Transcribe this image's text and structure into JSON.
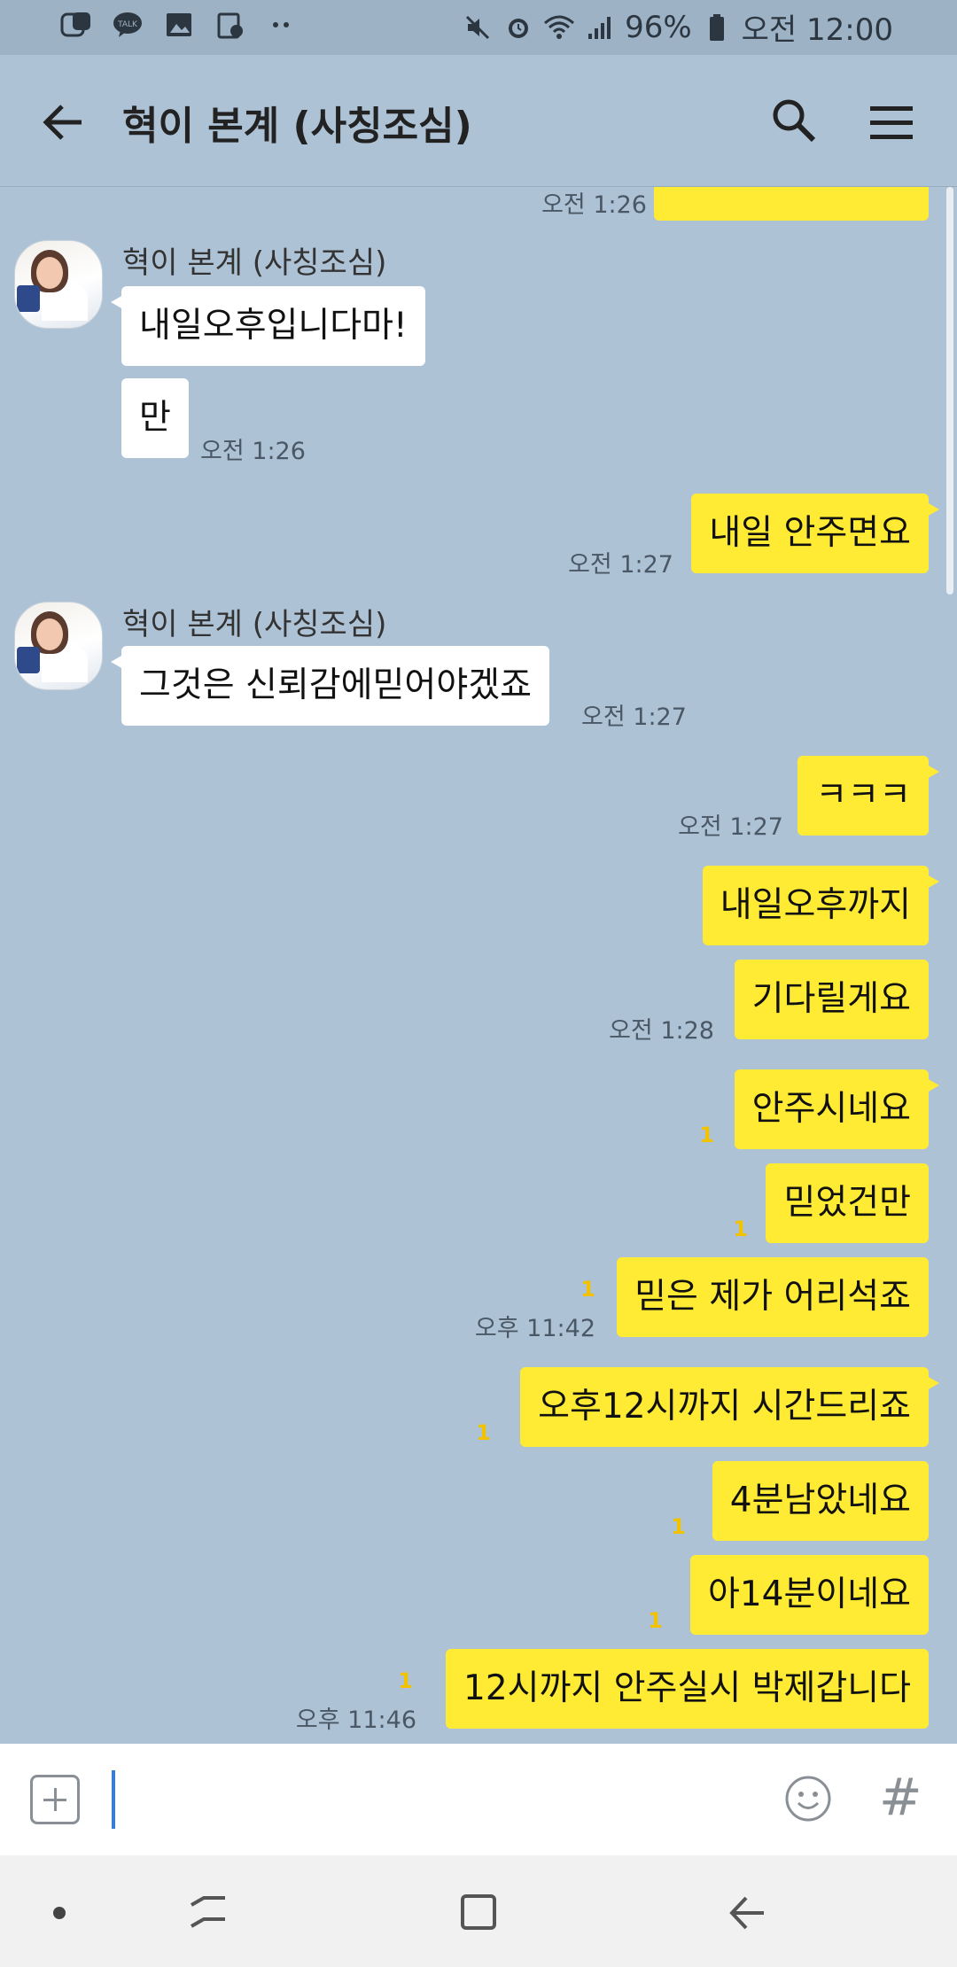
{
  "status": {
    "battery": "96%",
    "time": "오전 12:00"
  },
  "header": {
    "title": "혁이 본계 (사칭조심)"
  },
  "chat": {
    "partial_time": "오전 1:26",
    "sender1": "혁이 본계 (사칭조심)",
    "m1": "내일오후입니다마!",
    "m2": "만",
    "m2_time": "오전 1:26",
    "m3": "내일 안주면요",
    "m3_time": "오전 1:27",
    "sender2": "혁이 본계 (사칭조심)",
    "m4": "그것은 신뢰감에믿어야겠죠",
    "m4_time": "오전 1:27",
    "m5": "ㅋㅋㅋ",
    "m5_time": "오전 1:27",
    "m6": "내일오후까지",
    "m7": "기다릴게요",
    "m7_time": "오전 1:28",
    "m8": "안주시네요",
    "m8_unread": "1",
    "m9": "믿었건만",
    "m9_unread": "1",
    "m10": "믿은 제가 어리석죠",
    "m10_unread": "1",
    "m10_time": "오후 11:42",
    "m11": "오후12시까지 시간드리죠",
    "m11_unread": "1",
    "m12": "4분남았네요",
    "m12_unread": "1",
    "m13": "아14분이네요",
    "m13_unread": "1",
    "m14": "12시까지 안주실시 박제갑니다",
    "m14_unread": "1",
    "m14_time": "오후 11:46"
  },
  "input": {
    "value": "",
    "hash": "#"
  },
  "colors": {
    "background": "#aec2d6",
    "my_bubble": "#ffeb33",
    "their_bubble": "#ffffff",
    "unread": "#f2c200"
  },
  "icons": [
    "talk-app-icon",
    "kakaotalk-icon",
    "gallery-icon",
    "calendar-icon",
    "mute-icon",
    "alarm-icon",
    "wifi-icon",
    "signal-icon",
    "battery-icon",
    "back-arrow-icon",
    "search-icon",
    "menu-icon",
    "plus-icon",
    "emoji-icon",
    "hash-icon"
  ]
}
